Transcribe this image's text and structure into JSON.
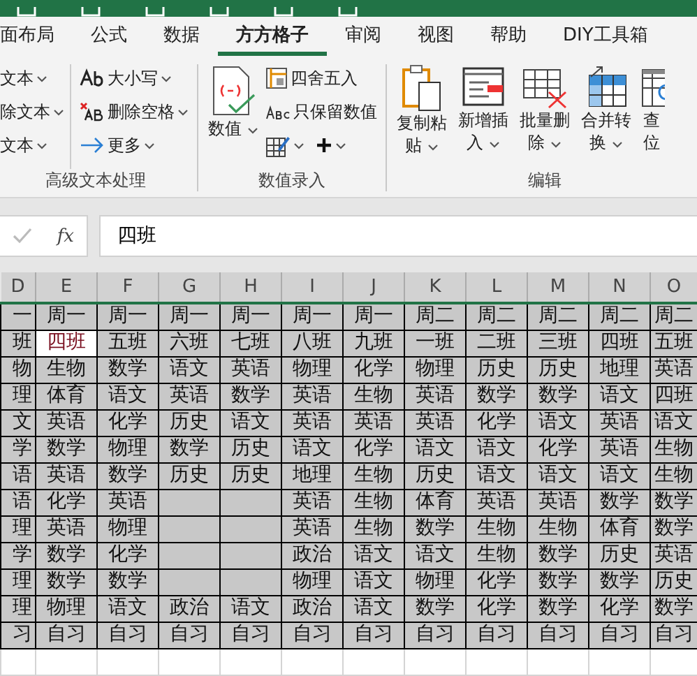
{
  "tabs": [
    {
      "label": "面布局",
      "selected": false
    },
    {
      "label": "公式",
      "selected": false
    },
    {
      "label": "数据",
      "selected": false
    },
    {
      "label": "方方格子",
      "selected": true
    },
    {
      "label": "审阅",
      "selected": false
    },
    {
      "label": "视图",
      "selected": false
    },
    {
      "label": "帮助",
      "selected": false
    },
    {
      "label": "DIY工具箱",
      "selected": false
    }
  ],
  "ribbon": {
    "groups": [
      {
        "label": "高级文本处理",
        "columns": [
          [
            [
              {
                "label": "文本",
                "dropdown": true
              }
            ],
            [
              {
                "label": "除文本",
                "dropdown": true
              }
            ],
            [
              {
                "label": "文本",
                "dropdown": true
              }
            ]
          ],
          [
            [
              {
                "label": "大小写",
                "dropdown": true
              }
            ],
            [
              {
                "label": "删除空格",
                "dropdown": true
              }
            ],
            [
              {
                "label": "更多",
                "dropdown": true
              }
            ]
          ]
        ]
      },
      {
        "label": "数值录入",
        "large": [
          {
            "lines": [
              "数值"
            ],
            "dropdown": true
          }
        ],
        "columns": [
          [
            [
              {
                "label": "四舍五入",
                "dropdown": false
              }
            ],
            [
              {
                "label": "只保留数值",
                "dropdown": false
              }
            ],
            [
              {
                "dropdown": true
              },
              {
                "dropdown": true
              }
            ]
          ]
        ]
      },
      {
        "label": "编辑",
        "large": [
          {
            "lines": [
              "复制粘",
              "贴"
            ],
            "dropdown": true
          },
          {
            "lines": [
              "新增插",
              "入"
            ],
            "dropdown": true
          },
          {
            "lines": [
              "批量删",
              "除"
            ],
            "dropdown": true
          },
          {
            "lines": [
              "合并转",
              "换"
            ],
            "dropdown": true
          },
          {
            "lines": [
              "查",
              "位"
            ],
            "dropdown": false
          }
        ]
      }
    ]
  },
  "formula_bar": {
    "fx": "fx",
    "value": "四班"
  },
  "grid": {
    "columns": [
      "D",
      "E",
      "F",
      "G",
      "H",
      "I",
      "J",
      "K",
      "L",
      "M",
      "N",
      "O"
    ],
    "rows": [
      [
        {
          "text": "一",
          "selected": false
        },
        {
          "text": "周一",
          "selected": false
        },
        {
          "text": "周一",
          "selected": false
        },
        {
          "text": "周一",
          "selected": false
        },
        {
          "text": "周一",
          "selected": false
        },
        {
          "text": "周一",
          "selected": false
        },
        {
          "text": "周一",
          "selected": false
        },
        {
          "text": "周二",
          "selected": false
        },
        {
          "text": "周二",
          "selected": false
        },
        {
          "text": "周二",
          "selected": false
        },
        {
          "text": "周二",
          "selected": false
        },
        {
          "text": "周二",
          "selected": false
        }
      ],
      [
        {
          "text": "班",
          "selected": false
        },
        {
          "text": "四班",
          "selected": true
        },
        {
          "text": "五班",
          "selected": false
        },
        {
          "text": "六班",
          "selected": false
        },
        {
          "text": "七班",
          "selected": false
        },
        {
          "text": "八班",
          "selected": false
        },
        {
          "text": "九班",
          "selected": false
        },
        {
          "text": "一班",
          "selected": false
        },
        {
          "text": "二班",
          "selected": false
        },
        {
          "text": "三班",
          "selected": false
        },
        {
          "text": "四班",
          "selected": false
        },
        {
          "text": "五班",
          "selected": false
        }
      ],
      [
        {
          "text": "物",
          "selected": false
        },
        {
          "text": "生物",
          "selected": false
        },
        {
          "text": "数学",
          "selected": false
        },
        {
          "text": "语文",
          "selected": false
        },
        {
          "text": "英语",
          "selected": false
        },
        {
          "text": "物理",
          "selected": false
        },
        {
          "text": "化学",
          "selected": false
        },
        {
          "text": "物理",
          "selected": false
        },
        {
          "text": "历史",
          "selected": false
        },
        {
          "text": "历史",
          "selected": false
        },
        {
          "text": "地理",
          "selected": false
        },
        {
          "text": "英语",
          "selected": false
        }
      ],
      [
        {
          "text": "理",
          "selected": false
        },
        {
          "text": "体育",
          "selected": false
        },
        {
          "text": "语文",
          "selected": false
        },
        {
          "text": "英语",
          "selected": false
        },
        {
          "text": "数学",
          "selected": false
        },
        {
          "text": "英语",
          "selected": false
        },
        {
          "text": "生物",
          "selected": false
        },
        {
          "text": "英语",
          "selected": false
        },
        {
          "text": "数学",
          "selected": false
        },
        {
          "text": "数学",
          "selected": false
        },
        {
          "text": "语文",
          "selected": false
        },
        {
          "text": "四班",
          "selected": false
        }
      ],
      [
        {
          "text": "文",
          "selected": false
        },
        {
          "text": "英语",
          "selected": false
        },
        {
          "text": "化学",
          "selected": false
        },
        {
          "text": "历史",
          "selected": false
        },
        {
          "text": "语文",
          "selected": false
        },
        {
          "text": "英语",
          "selected": false
        },
        {
          "text": "英语",
          "selected": false
        },
        {
          "text": "英语",
          "selected": false
        },
        {
          "text": "化学",
          "selected": false
        },
        {
          "text": "语文",
          "selected": false
        },
        {
          "text": "英语",
          "selected": false
        },
        {
          "text": "语文",
          "selected": false
        }
      ],
      [
        {
          "text": "学",
          "selected": false
        },
        {
          "text": "数学",
          "selected": false
        },
        {
          "text": "物理",
          "selected": false
        },
        {
          "text": "数学",
          "selected": false
        },
        {
          "text": "历史",
          "selected": false
        },
        {
          "text": "语文",
          "selected": false
        },
        {
          "text": "化学",
          "selected": false
        },
        {
          "text": "语文",
          "selected": false
        },
        {
          "text": "语文",
          "selected": false
        },
        {
          "text": "化学",
          "selected": false
        },
        {
          "text": "英语",
          "selected": false
        },
        {
          "text": "生物",
          "selected": false
        }
      ],
      [
        {
          "text": "语",
          "selected": false
        },
        {
          "text": "英语",
          "selected": false
        },
        {
          "text": "数学",
          "selected": false
        },
        {
          "text": "历史",
          "selected": false
        },
        {
          "text": "历史",
          "selected": false
        },
        {
          "text": "地理",
          "selected": false
        },
        {
          "text": "生物",
          "selected": false
        },
        {
          "text": "历史",
          "selected": false
        },
        {
          "text": "语文",
          "selected": false
        },
        {
          "text": "语文",
          "selected": false
        },
        {
          "text": "语文",
          "selected": false
        },
        {
          "text": "生物",
          "selected": false
        }
      ],
      [
        {
          "text": "语",
          "selected": false
        },
        {
          "text": "化学",
          "selected": false
        },
        {
          "text": "英语",
          "selected": false
        },
        {
          "selected": false
        },
        {
          "selected": false
        },
        {
          "text": "英语",
          "selected": false
        },
        {
          "text": "生物",
          "selected": false
        },
        {
          "text": "体育",
          "selected": false
        },
        {
          "text": "英语",
          "selected": false
        },
        {
          "text": "英语",
          "selected": false
        },
        {
          "text": "数学",
          "selected": false
        },
        {
          "text": "数学",
          "selected": false
        }
      ],
      [
        {
          "text": "理",
          "selected": false
        },
        {
          "text": "英语",
          "selected": false
        },
        {
          "text": "物理",
          "selected": false
        },
        {
          "selected": false
        },
        {
          "selected": false
        },
        {
          "text": "英语",
          "selected": false
        },
        {
          "text": "生物",
          "selected": false
        },
        {
          "text": "数学",
          "selected": false
        },
        {
          "text": "生物",
          "selected": false
        },
        {
          "text": "生物",
          "selected": false
        },
        {
          "text": "体育",
          "selected": false
        },
        {
          "text": "数学",
          "selected": false
        }
      ],
      [
        {
          "text": "学",
          "selected": false
        },
        {
          "text": "数学",
          "selected": false
        },
        {
          "text": "化学",
          "selected": false
        },
        {
          "selected": false
        },
        {
          "selected": false
        },
        {
          "text": "政治",
          "selected": false
        },
        {
          "text": "语文",
          "selected": false
        },
        {
          "text": "语文",
          "selected": false
        },
        {
          "text": "生物",
          "selected": false
        },
        {
          "text": "数学",
          "selected": false
        },
        {
          "text": "历史",
          "selected": false
        },
        {
          "text": "英语",
          "selected": false
        }
      ],
      [
        {
          "text": "理",
          "selected": false
        },
        {
          "text": "数学",
          "selected": false
        },
        {
          "text": "数学",
          "selected": false
        },
        {
          "selected": false
        },
        {
          "selected": false
        },
        {
          "text": "物理",
          "selected": false
        },
        {
          "text": "语文",
          "selected": false
        },
        {
          "text": "物理",
          "selected": false
        },
        {
          "text": "化学",
          "selected": false
        },
        {
          "text": "数学",
          "selected": false
        },
        {
          "text": "数学",
          "selected": false
        },
        {
          "text": "历史",
          "selected": false
        }
      ],
      [
        {
          "text": "理",
          "selected": false
        },
        {
          "text": "物理",
          "selected": false
        },
        {
          "text": "语文",
          "selected": false
        },
        {
          "text": "政治",
          "selected": false
        },
        {
          "text": "语文",
          "selected": false
        },
        {
          "text": "政治",
          "selected": false
        },
        {
          "text": "语文",
          "selected": false
        },
        {
          "text": "数学",
          "selected": false
        },
        {
          "text": "化学",
          "selected": false
        },
        {
          "text": "数学",
          "selected": false
        },
        {
          "text": "化学",
          "selected": false
        },
        {
          "text": "数学",
          "selected": false
        }
      ],
      [
        {
          "text": "习",
          "selected": false
        },
        {
          "text": "自习",
          "selected": false
        },
        {
          "text": "自习",
          "selected": false
        },
        {
          "text": "自习",
          "selected": false
        },
        {
          "text": "自习",
          "selected": false
        },
        {
          "text": "自习",
          "selected": false
        },
        {
          "text": "自习",
          "selected": false
        },
        {
          "text": "自习",
          "selected": false
        },
        {
          "text": "自习",
          "selected": false
        },
        {
          "text": "自习",
          "selected": false
        },
        {
          "text": "自习",
          "selected": false
        },
        {
          "text": "自习",
          "selected": false
        }
      ]
    ]
  }
}
